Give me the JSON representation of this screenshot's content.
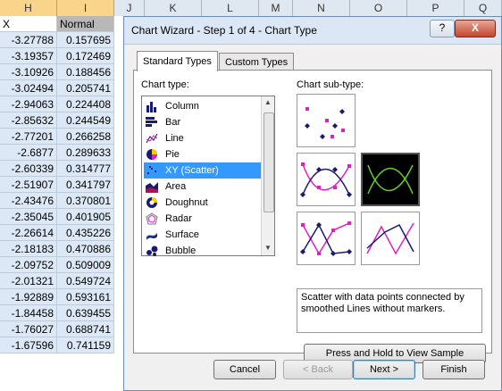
{
  "spreadsheet": {
    "columns": [
      "H",
      "I",
      "J",
      "K",
      "L",
      "M",
      "N",
      "O",
      "P",
      "Q"
    ],
    "headers": {
      "x": "X",
      "normal": "Normal"
    },
    "rows": [
      [
        "-3.27788",
        "0.157695"
      ],
      [
        "-3.19357",
        "0.172469"
      ],
      [
        "-3.10926",
        "0.188456"
      ],
      [
        "-3.02494",
        "0.205741"
      ],
      [
        "-2.94063",
        "0.224408"
      ],
      [
        "-2.85632",
        "0.244549"
      ],
      [
        "-2.77201",
        "0.266258"
      ],
      [
        "-2.6877",
        "0.289633"
      ],
      [
        "-2.60339",
        "0.314777"
      ],
      [
        "-2.51907",
        "0.341797"
      ],
      [
        "-2.43476",
        "0.370801"
      ],
      [
        "-2.35045",
        "0.401905"
      ],
      [
        "-2.26614",
        "0.435226"
      ],
      [
        "-2.18183",
        "0.470886"
      ],
      [
        "-2.09752",
        "0.509009"
      ],
      [
        "-2.01321",
        "0.549724"
      ],
      [
        "-1.92889",
        "0.593161"
      ],
      [
        "-1.84458",
        "0.639455"
      ],
      [
        "-1.76027",
        "0.688741"
      ],
      [
        "-1.67596",
        "0.741159"
      ]
    ]
  },
  "dialog": {
    "title": "Chart Wizard - Step 1 of 4 - Chart Type",
    "help_label": "?",
    "close_label": "X",
    "tabs": [
      {
        "label": "Standard Types",
        "active": true
      },
      {
        "label": "Custom Types",
        "active": false
      }
    ],
    "chart_type_label": "Chart type:",
    "chart_subtype_label": "Chart sub-type:",
    "chart_types": [
      {
        "label": "Column",
        "icon": "column-chart-icon"
      },
      {
        "label": "Bar",
        "icon": "bar-chart-icon"
      },
      {
        "label": "Line",
        "icon": "line-chart-icon"
      },
      {
        "label": "Pie",
        "icon": "pie-chart-icon"
      },
      {
        "label": "XY (Scatter)",
        "icon": "scatter-chart-icon",
        "selected": true
      },
      {
        "label": "Area",
        "icon": "area-chart-icon"
      },
      {
        "label": "Doughnut",
        "icon": "doughnut-chart-icon"
      },
      {
        "label": "Radar",
        "icon": "radar-chart-icon"
      },
      {
        "label": "Surface",
        "icon": "surface-chart-icon"
      },
      {
        "label": "Bubble",
        "icon": "bubble-chart-icon"
      }
    ],
    "description": "Scatter with data points connected by smoothed Lines without markers.",
    "sample_button": "Press and Hold to View Sample",
    "buttons": {
      "cancel": "Cancel",
      "back": "< Back",
      "next": "Next >",
      "finish": "Finish"
    },
    "colors": {
      "accent": "#3399ff",
      "marker_pink": "#e020c0",
      "marker_navy": "#1a1a6e",
      "curve_green": "#66cc33"
    }
  }
}
